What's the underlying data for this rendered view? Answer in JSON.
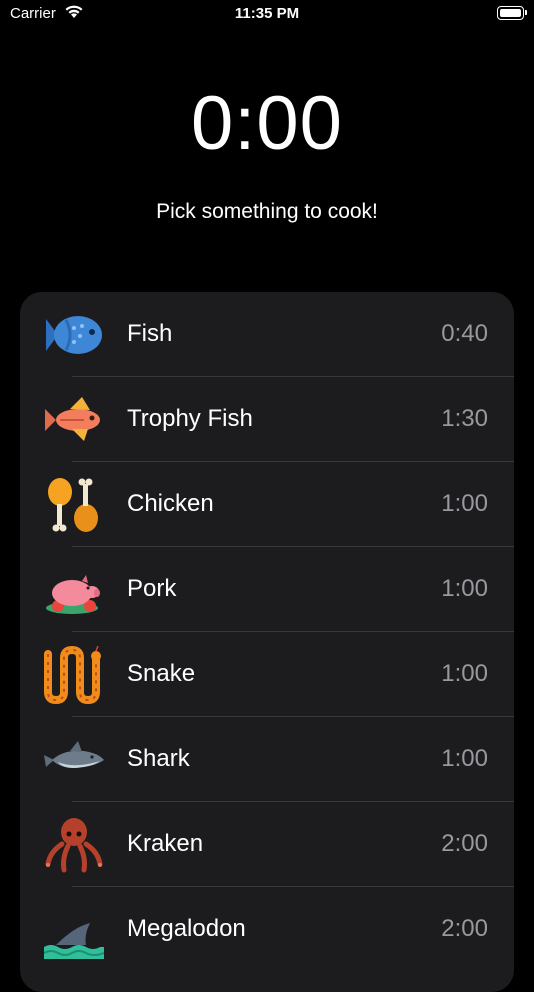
{
  "status": {
    "carrier": "Carrier",
    "time": "11:35 PM"
  },
  "timer": {
    "display": "0:00",
    "prompt": "Pick something to cook!"
  },
  "items": [
    {
      "name": "Fish",
      "time": "0:40",
      "icon": "fish-icon"
    },
    {
      "name": "Trophy Fish",
      "time": "1:30",
      "icon": "trophy-fish-icon"
    },
    {
      "name": "Chicken",
      "time": "1:00",
      "icon": "chicken-leg-icon"
    },
    {
      "name": "Pork",
      "time": "1:00",
      "icon": "pig-icon"
    },
    {
      "name": "Snake",
      "time": "1:00",
      "icon": "snake-icon"
    },
    {
      "name": "Shark",
      "time": "1:00",
      "icon": "shark-icon"
    },
    {
      "name": "Kraken",
      "time": "2:00",
      "icon": "octopus-icon"
    },
    {
      "name": "Megalodon",
      "time": "2:00",
      "icon": "shark-fin-icon"
    }
  ],
  "colors": {
    "background": "#000000",
    "card": "#1c1c1e",
    "secondary_text": "#98989e",
    "separator": "#38383a"
  }
}
